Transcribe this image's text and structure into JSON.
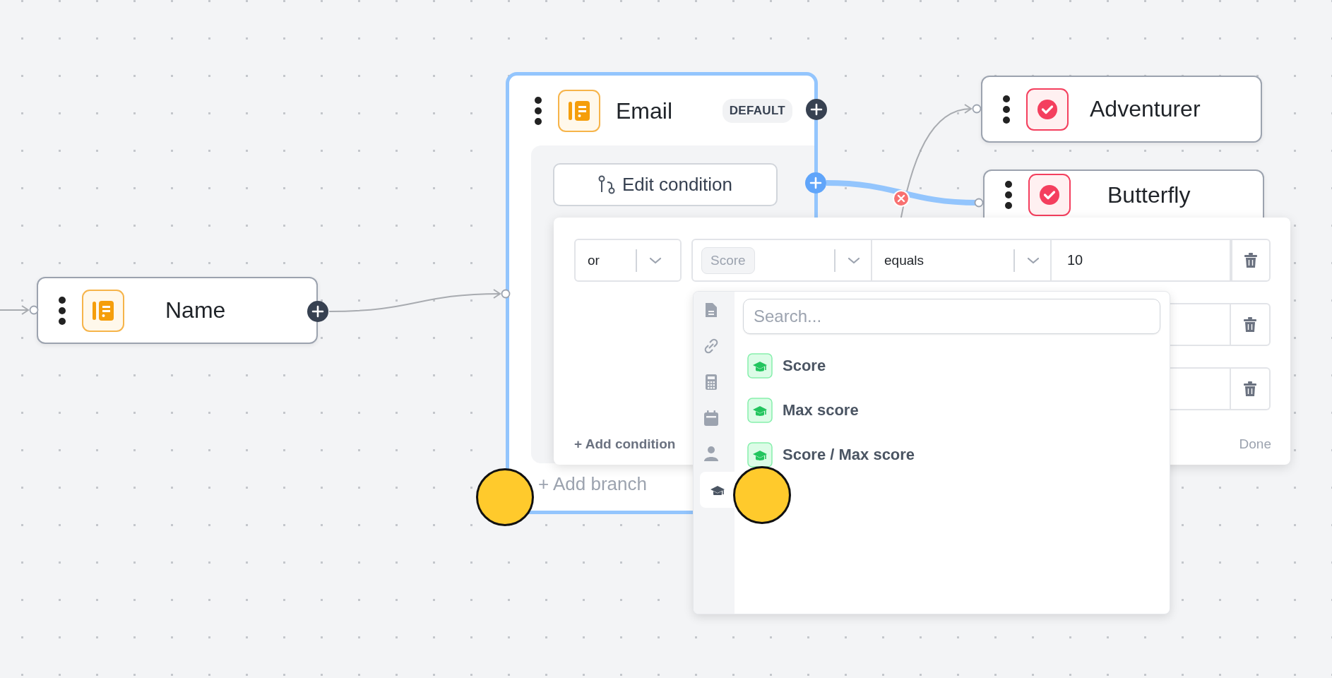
{
  "nodes": [
    {
      "kind": "input",
      "title": "Name"
    },
    {
      "kind": "outcome",
      "title": "Adventurer"
    },
    {
      "kind": "outcome",
      "title": "Butterfly"
    }
  ],
  "group": {
    "kind": "input",
    "title": "Email",
    "badge": "DEFAULT",
    "selected": true,
    "edit_button": "Edit condition",
    "add_branch": "+ Add branch"
  },
  "condition_editor": {
    "rows": [
      {
        "kind": "full",
        "logic": "or",
        "variable": "Score",
        "operator": "equals",
        "value": "10"
      },
      {
        "kind": "partial"
      },
      {
        "kind": "partial"
      }
    ],
    "add_condition": "+ Add condition",
    "done": "Done"
  },
  "variable_menu": {
    "categories": [
      {
        "kind": "document",
        "selected": false
      },
      {
        "kind": "link",
        "selected": false
      },
      {
        "kind": "calculator",
        "selected": false
      },
      {
        "kind": "calendar",
        "selected": false
      },
      {
        "kind": "person",
        "selected": false
      },
      {
        "kind": "cap",
        "selected": true
      }
    ],
    "search": {
      "placeholder": "Search..."
    },
    "items": [
      {
        "label": "Score"
      },
      {
        "label": "Max score"
      },
      {
        "label": "Score / Max score"
      }
    ]
  }
}
